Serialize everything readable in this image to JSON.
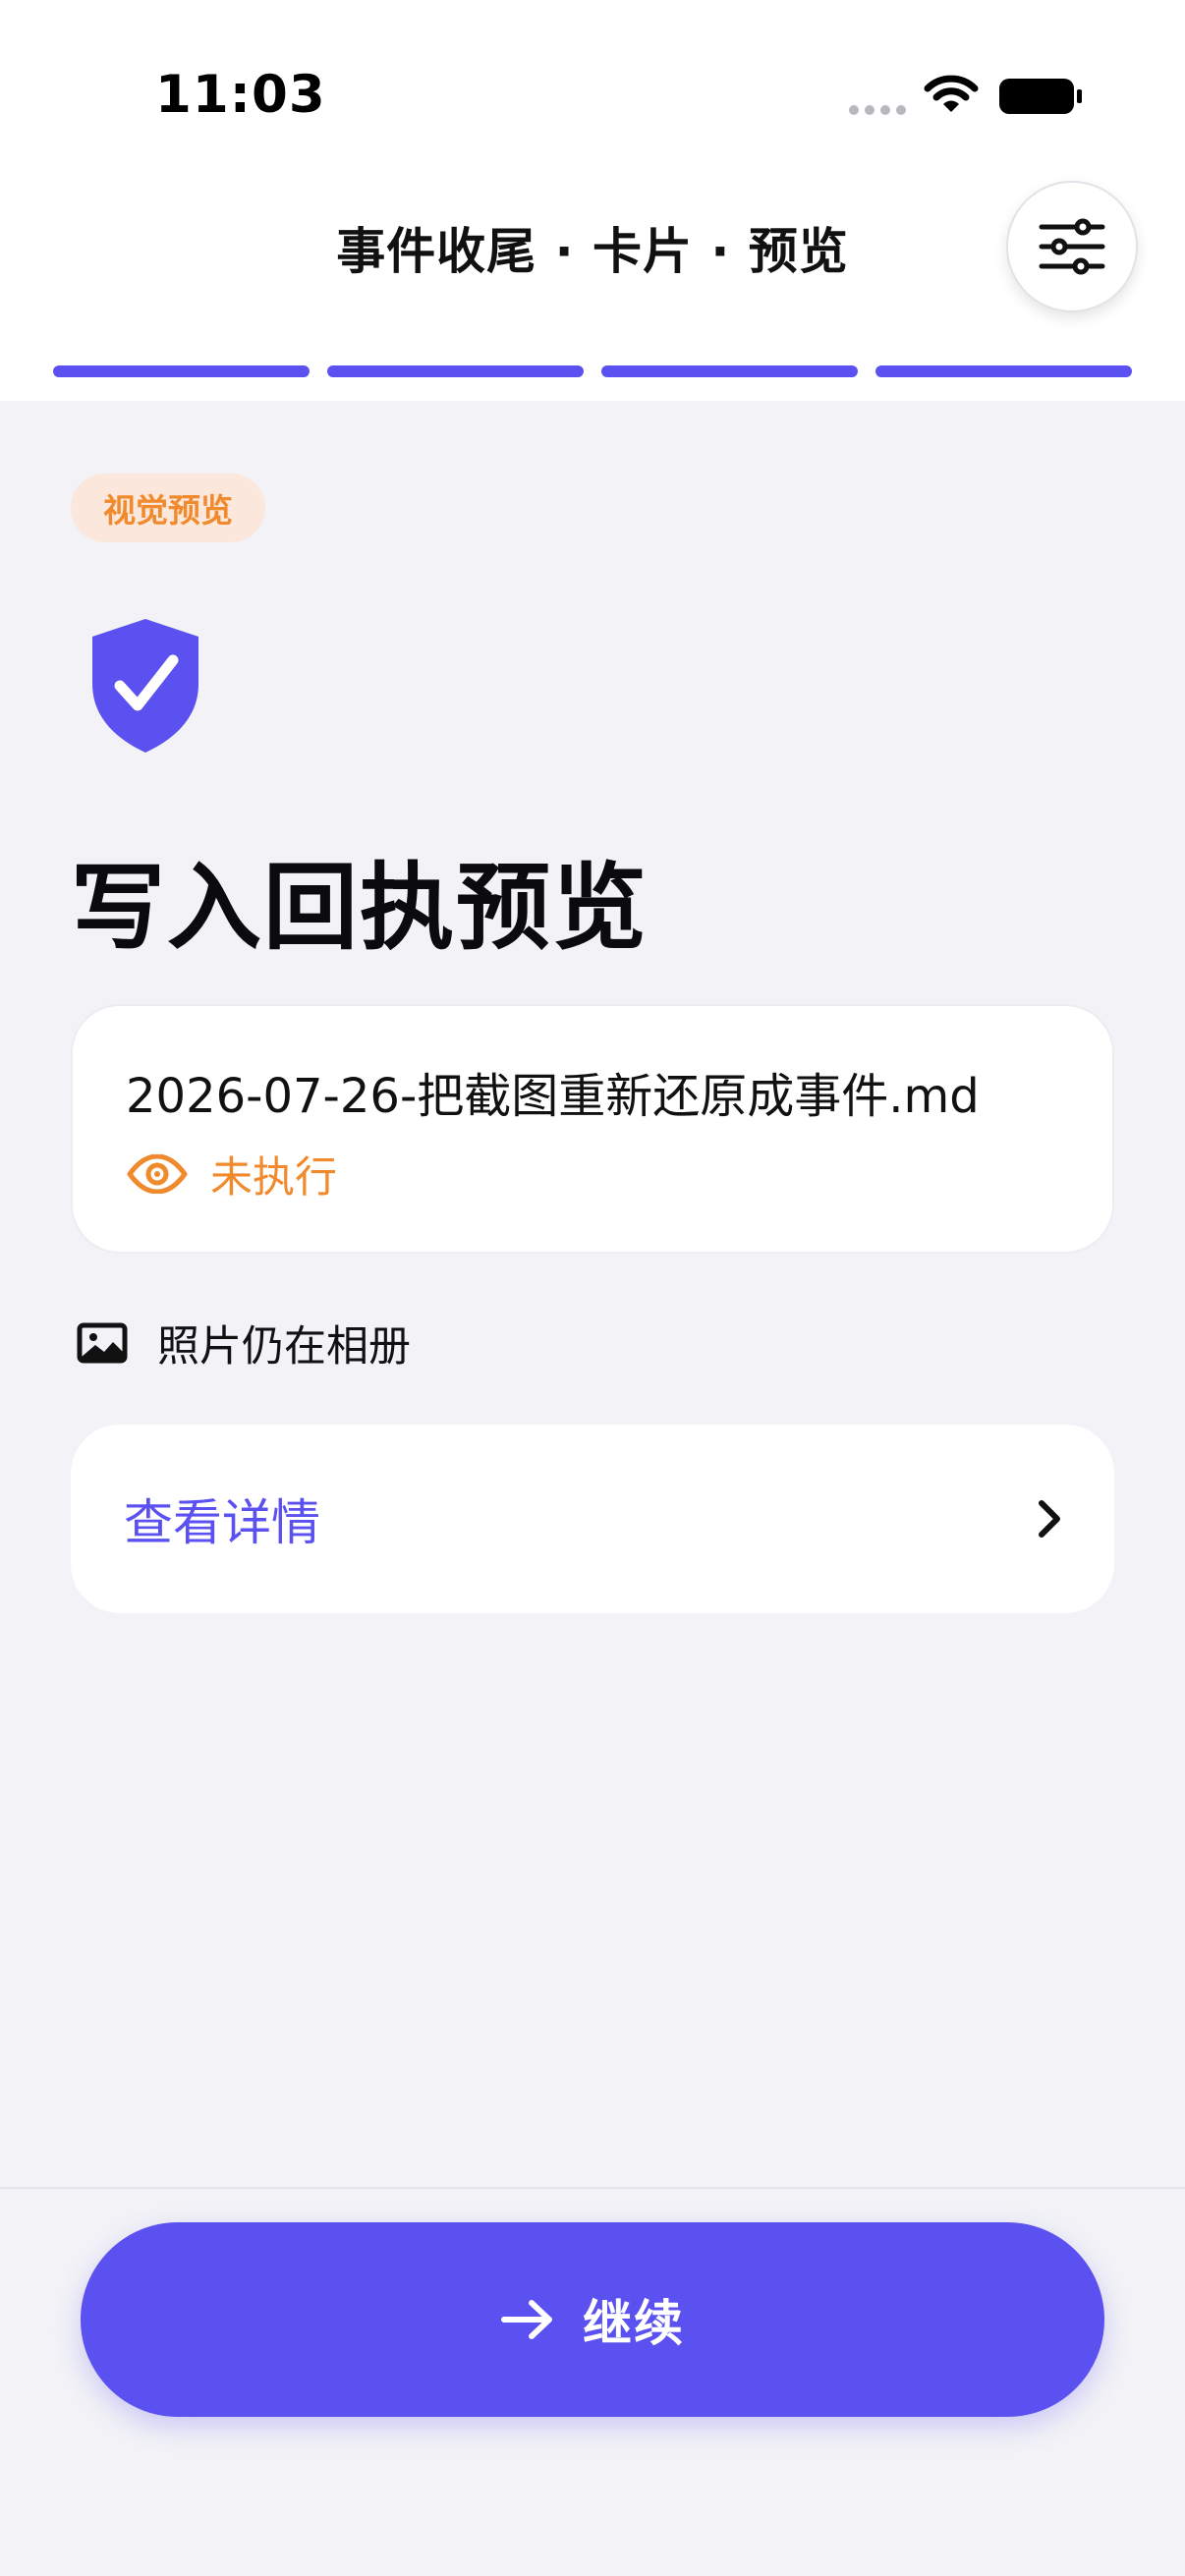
{
  "status_bar": {
    "time": "11:03",
    "icons": [
      "signal-dots-icon",
      "wifi-icon",
      "battery-icon"
    ]
  },
  "nav": {
    "title": "事件收尾 · 卡片 · 预览",
    "settings_icon": "sliders-icon"
  },
  "progress": {
    "total_steps": 4,
    "completed_steps": 4
  },
  "badge": {
    "label": "视觉预览"
  },
  "main": {
    "icon": "shield-check-icon",
    "title": "写入回执预览",
    "file_card": {
      "file_name": "2026-07-26-把截图重新还原成事件.md",
      "status_icon": "eye-icon",
      "status": "未执行"
    },
    "photo_note": {
      "icon": "photo-icon",
      "text": "照片仍在相册"
    },
    "detail_row": {
      "label": "查看详情",
      "icon": "chevron-right-icon"
    }
  },
  "footer": {
    "continue_icon": "arrow-right-icon",
    "continue_label": "继续"
  },
  "colors": {
    "accent": "#5B50F0",
    "warning": "#F08A2C",
    "badge_bg": "#FBE7DB",
    "background": "#F2F2F7",
    "card": "#FFFFFF"
  }
}
